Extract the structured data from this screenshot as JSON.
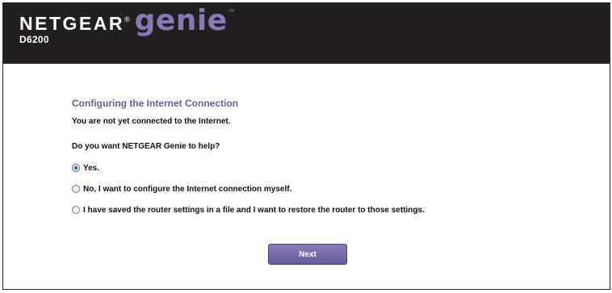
{
  "header": {
    "brand_name": "NETGEAR",
    "brand_registered": "®",
    "product_name": "genie",
    "product_trademark": "™",
    "model": "D6200"
  },
  "main": {
    "title": "Configuring the Internet Connection",
    "status_text": "You are not yet connected to the Internet.",
    "question": "Do you want NETGEAR Genie to help?",
    "options": [
      {
        "label": "Yes.",
        "selected": true
      },
      {
        "label": "No, I want to configure the Internet connection myself.",
        "selected": false
      },
      {
        "label": "I have saved the router settings in a file and I want to restore the router to those settings.",
        "selected": false
      }
    ],
    "next_label": "Next"
  },
  "colors": {
    "header_background": "#231f20",
    "brand_purple": "#8a77b5",
    "title_purple": "#6c5b9e",
    "button_purple": "#7a68aa"
  }
}
